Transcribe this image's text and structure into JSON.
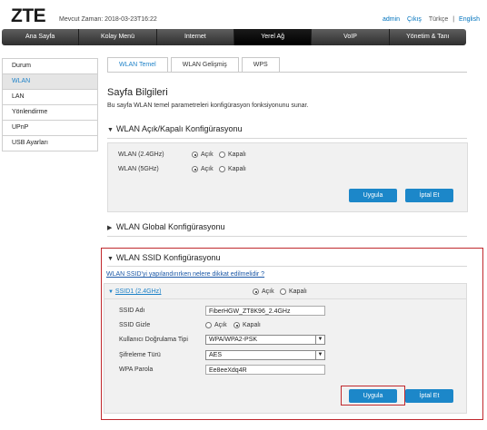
{
  "header": {
    "logo": "ZTE",
    "time_label": "Mevcut Zaman: 2018-03-23T16:22",
    "links": {
      "admin": "admin",
      "logout": "Çıkış",
      "lang_tr": "Türkçe",
      "lang_sep": "|",
      "lang_en": "English"
    }
  },
  "nav": [
    "Ana Sayfa",
    "Kolay Menü",
    "Internet",
    "Yerel Ağ",
    "VoIP",
    "Yönetim & Tanı"
  ],
  "sidebar": [
    "Durum",
    "WLAN",
    "LAN",
    "Yönlendirme",
    "UPnP",
    "USB Ayarları"
  ],
  "subtabs": [
    "WLAN Temel",
    "WLAN Gelişmiş",
    "WPS"
  ],
  "page": {
    "title": "Sayfa Bilgileri",
    "desc": "Bu sayfa WLAN temel parametreleri konfigürasyon fonksiyonunu sunar."
  },
  "onoff": {
    "title": "WLAN Açık/Kapalı Konfigürasyonu",
    "rows": [
      {
        "label": "WLAN (2.4GHz)",
        "on": "Açık",
        "off": "Kapalı"
      },
      {
        "label": "WLAN (5GHz)",
        "on": "Açık",
        "off": "Kapalı"
      }
    ],
    "apply": "Uygula",
    "cancel": "İptal Et"
  },
  "global": {
    "title": "WLAN Global Konfigürasyonu"
  },
  "ssid": {
    "title": "WLAN SSID Konfigürasyonu",
    "link": "WLAN SSID'yi yapılandırırken nelere dikkat edilmelidir ?",
    "name": "SSID1 (2.4GHz)",
    "on": "Açık",
    "off": "Kapalı",
    "fields": {
      "ssid_label": "SSID Adı",
      "ssid_value": "FiberHGW_ZT8K96_2.4GHz",
      "hide_label": "SSID Gizle",
      "hide_on": "Açık",
      "hide_off": "Kapalı",
      "auth_label": "Kullanıcı Doğrulama Tipi",
      "auth_value": "WPA/WPA2-PSK",
      "enc_label": "Şifreleme Türü",
      "enc_value": "AES",
      "pass_label": "WPA Parola",
      "pass_value": "Ee8eeXdq4R"
    },
    "apply": "Uygula",
    "cancel": "İptal Et"
  },
  "colors": {
    "accent": "#1c87c9",
    "highlight": "#c0282d",
    "nav_dark": "#2e2e2e"
  }
}
